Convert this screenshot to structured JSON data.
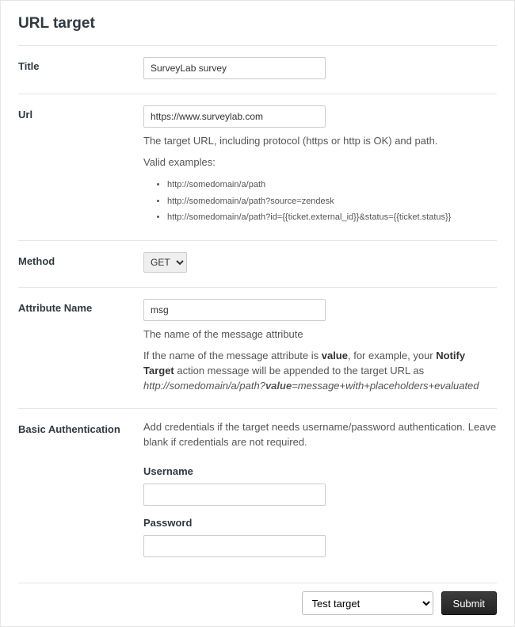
{
  "heading": "URL target",
  "title": {
    "label": "Title",
    "value": "SurveyLab survey"
  },
  "url": {
    "label": "Url",
    "value": "https://www.surveylab.com",
    "help": "The target URL, including protocol (https or http is OK) and path.",
    "examples_label": "Valid examples:",
    "examples": [
      "http://somedomain/a/path",
      "http://somedomain/a/path?source=zendesk",
      "http://somedomain/a/path?id={{ticket.external_id}}&status={{ticket.status}}"
    ]
  },
  "method": {
    "label": "Method",
    "selected": "GET"
  },
  "attribute": {
    "label": "Attribute Name",
    "value": "msg",
    "help1": "The name of the message attribute",
    "help2_pre": "If the name of the message attribute is ",
    "help2_bold1": "value",
    "help2_mid": ", for example, your ",
    "help2_bold2": "Notify Target",
    "help2_post": " action message will be appended to the target URL as",
    "help2_italic_pre": "http://somedomain/a/path?",
    "help2_italic_bold": "value",
    "help2_italic_post": "=message+with+placeholders+evaluated"
  },
  "auth": {
    "label": "Basic Authentication",
    "help": "Add credentials if the target needs username/password authentication. Leave blank if credentials are not required.",
    "username_label": "Username",
    "password_label": "Password"
  },
  "footer": {
    "test_target_label": "Test target",
    "submit_label": "Submit"
  }
}
